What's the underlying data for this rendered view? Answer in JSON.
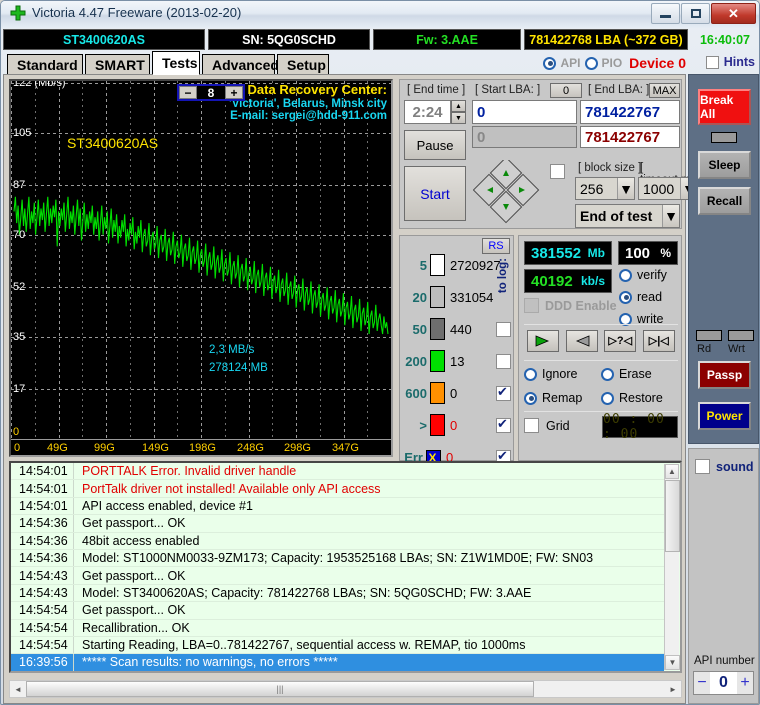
{
  "window": {
    "title": "Victoria 4.47  Freeware (2013-02-20)",
    "icon": "green-cross-icon",
    "buttons": {
      "minimize": "minimize-icon",
      "maximize": "maximize-icon",
      "close": "✕"
    }
  },
  "infobar": {
    "model": "ST3400620AS",
    "serial": "SN: 5QG0SCHD",
    "firmware": "Fw: 3.AAE",
    "capacity": "781422768 LBA (~372 GB)",
    "clock": "16:40:07",
    "colors": {
      "model": "#17e8e8",
      "serial": "#ffffff",
      "firmware": "#24e024",
      "capacity": "#ffe400",
      "clock": "#0bbd0b"
    }
  },
  "tabs": [
    {
      "label": "Standard",
      "active": false
    },
    {
      "label": "SMART",
      "active": false
    },
    {
      "label": "Tests",
      "active": true
    },
    {
      "label": "Advanced",
      "active": false
    },
    {
      "label": "Setup",
      "active": false
    }
  ],
  "device": {
    "api_label": "API",
    "pio_label": "PIO",
    "selected": "API",
    "device_label": "Device 0",
    "hints_label": "Hints",
    "hints_checked": false
  },
  "chart_data": {
    "type": "line",
    "title": "ST3400620AS",
    "ylabel": "(Mb/s)",
    "xlabel": "",
    "ytick_labels": [
      "122",
      "105",
      "87",
      "70",
      "52",
      "35",
      "17",
      "0"
    ],
    "yticks": [
      122,
      105,
      87,
      70,
      52,
      35,
      17,
      0
    ],
    "ylim": [
      0,
      122
    ],
    "xtick_labels": [
      "0",
      "49G",
      "99G",
      "149G",
      "198G",
      "248G",
      "298G",
      "347G"
    ],
    "xlim": [
      0,
      372
    ],
    "grid": true,
    "line_color": "#00e000",
    "background": "#000000",
    "unit_label": "122 (Mb/s)",
    "series": [
      {
        "name": "read speed",
        "values": [
          78,
          83,
          74,
          80,
          70,
          76,
          82,
          73,
          79,
          71,
          77,
          83,
          72,
          78,
          74,
          81,
          70,
          76,
          82,
          73,
          79,
          75,
          81,
          71,
          77,
          83,
          73,
          79,
          74,
          80,
          76,
          82,
          66,
          78,
          73,
          79,
          75,
          81,
          71,
          77,
          83,
          72,
          78,
          74,
          80,
          70,
          76,
          82,
          73,
          79,
          68,
          75,
          81,
          71,
          77,
          72,
          78,
          74,
          80,
          70,
          76,
          72,
          78,
          68,
          74,
          80,
          70,
          76,
          72,
          78,
          67,
          73,
          79,
          69,
          75,
          71,
          77,
          67,
          73,
          69,
          75,
          71,
          77,
          66,
          72,
          68,
          74,
          70,
          76,
          65,
          71,
          67,
          73,
          69,
          75,
          64,
          70,
          72,
          66,
          68,
          74,
          63,
          69,
          71,
          65,
          67,
          73,
          62,
          68,
          70,
          64,
          66,
          72,
          61,
          67,
          69,
          63,
          65,
          71,
          60,
          66,
          68,
          62,
          64,
          70,
          59,
          65,
          67,
          61,
          63,
          69,
          58,
          64,
          66,
          60,
          62,
          68,
          57,
          63,
          65,
          59,
          61,
          67,
          56,
          62,
          64,
          58,
          60,
          66,
          55,
          61,
          63,
          57,
          59,
          65,
          54,
          60,
          62,
          56,
          58,
          64,
          53,
          59,
          61,
          55,
          57,
          63,
          52,
          58,
          60,
          54,
          56,
          62,
          51,
          57,
          59,
          53,
          55,
          61,
          50,
          56,
          58,
          52,
          54,
          60,
          49,
          55,
          57,
          51,
          53,
          59,
          48,
          54,
          56,
          50,
          52,
          58,
          47,
          53,
          55,
          49,
          51,
          57,
          46,
          52,
          54,
          48,
          50,
          56,
          45,
          51,
          53,
          47,
          49,
          55,
          44,
          50,
          52,
          46,
          48,
          54,
          43,
          49,
          51,
          45,
          47,
          53,
          42,
          48,
          50,
          44,
          46,
          52,
          41,
          47,
          49,
          43,
          45,
          51,
          40,
          46,
          48,
          42,
          44,
          50,
          39,
          45,
          47,
          41,
          43,
          49,
          38,
          44,
          46,
          40,
          42,
          48,
          37,
          43,
          45,
          39,
          41,
          47,
          36,
          42,
          44,
          38,
          40,
          46,
          37,
          41,
          43,
          39,
          36,
          42,
          38,
          40,
          36
        ]
      }
    ],
    "annotations": [
      {
        "text": "2,3 MB/s",
        "color": "#19d7f2"
      },
      {
        "text": "278124 MB",
        "color": "#19d7f2"
      }
    ],
    "watermark": {
      "line1": "Data Recovery Center:",
      "line2": "'Victoria', Belarus, Minsk city",
      "line3": "E-mail: sergei@hdd-911.com"
    },
    "zoom_control": {
      "minus": "−",
      "value": "8",
      "plus": "+"
    }
  },
  "controls": {
    "end_time_label": "[ End time ]",
    "end_time_value": "2:24",
    "start_lba_label": "[ Start LBA: ]",
    "start_lba_button": "0",
    "start_lba_value": "0",
    "start_lba_value2": "0",
    "end_lba_label": "[ End LBA: ]",
    "end_lba_button": "MAX",
    "end_lba_value": "781422767",
    "end_lba_value2": "781422767",
    "pause_button": "Pause",
    "start_button": "Start",
    "block_size_label": "[ block size ]",
    "block_size_value": "256",
    "timeout_label": "[ timeout,ms ]",
    "timeout_value": "1000",
    "end_of_test_value": "End of test"
  },
  "counters": {
    "rs_button": "RS",
    "to_log_label": "to log:",
    "rows": [
      {
        "threshold": "5",
        "color": "#ffffff",
        "value": "2720927",
        "checkbox": null
      },
      {
        "threshold": "20",
        "color": "#bdbdbd",
        "value": "331054",
        "checkbox": null
      },
      {
        "threshold": "50",
        "color": "#6e6e6e",
        "value": "440",
        "checkbox": false
      },
      {
        "threshold": "200",
        "color": "#00e000",
        "value": "13",
        "checkbox": false
      },
      {
        "threshold": "600",
        "color": "#ff9000",
        "value": "0",
        "checkbox": true
      },
      {
        "threshold": ">",
        "color": "#ff0000",
        "value": "0",
        "checkbox": true
      },
      {
        "threshold": "Err",
        "color": "#0000d0",
        "value": "0",
        "checkbox": true
      }
    ]
  },
  "stats": {
    "processed_value": "381552",
    "processed_unit": "Mb",
    "percent_value": "100",
    "percent_unit": "%",
    "speed_value": "40192",
    "speed_unit": "kb/s",
    "ddd_label": "DDD Enable",
    "ddd_checked": false,
    "modes": [
      {
        "label": "verify",
        "selected": false
      },
      {
        "label": "read",
        "selected": true
      },
      {
        "label": "write",
        "selected": false
      }
    ],
    "transport": [
      {
        "name": "play-forward-icon"
      },
      {
        "name": "play-reverse-icon"
      },
      {
        "name": "seek-random-icon"
      },
      {
        "name": "seek-end-icon"
      }
    ],
    "actions": [
      {
        "label": "Ignore",
        "selected": false
      },
      {
        "label": "Erase",
        "selected": false
      },
      {
        "label": "Remap",
        "selected": true
      },
      {
        "label": "Restore",
        "selected": false
      }
    ],
    "grid_label": "Grid",
    "grid_checked": false,
    "timer_display": "00 : 00 : 00"
  },
  "log": {
    "entries": [
      {
        "time": "14:54:01",
        "message": "PORTTALK Error. Invalid driver handle",
        "color": "#e00000",
        "selected": false
      },
      {
        "time": "14:54:01",
        "message": "PortTalk driver not installed! Available only API access",
        "color": "#e00000",
        "selected": false
      },
      {
        "time": "14:54:01",
        "message": "API access enabled, device #1",
        "color": "#000000",
        "selected": false
      },
      {
        "time": "14:54:36",
        "message": "Get passport... OK",
        "color": "#000000",
        "selected": false
      },
      {
        "time": "14:54:36",
        "message": "48bit access enabled",
        "color": "#000000",
        "selected": false
      },
      {
        "time": "14:54:36",
        "message": "Model: ST1000NM0033-9ZM173; Capacity: 1953525168 LBAs; SN: Z1W1MD0E; FW: SN03",
        "color": "#000000",
        "selected": false
      },
      {
        "time": "14:54:43",
        "message": "Get passport... OK",
        "color": "#000000",
        "selected": false
      },
      {
        "time": "14:54:43",
        "message": "Model: ST3400620AS; Capacity: 781422768 LBAs; SN: 5QG0SCHD; FW: 3.AAE",
        "color": "#000000",
        "selected": false
      },
      {
        "time": "14:54:54",
        "message": "Get passport... OK",
        "color": "#000000",
        "selected": false
      },
      {
        "time": "14:54:54",
        "message": "Recallibration... OK",
        "color": "#000000",
        "selected": false
      },
      {
        "time": "14:54:54",
        "message": "Starting Reading, LBA=0..781422767, sequential access w. REMAP, tio 1000ms",
        "color": "#000000",
        "selected": false
      },
      {
        "time": "16:39:56",
        "message": "***** Scan results: no warnings, no errors *****",
        "color": "#ffffff",
        "selected": true
      }
    ]
  },
  "sidebar": {
    "break_all": "Break All",
    "sleep": "Sleep",
    "recall": "Recall",
    "rd_label": "Rd",
    "wrt_label": "Wrt",
    "passp": "Passp",
    "power": "Power",
    "sound_label": "sound",
    "sound_checked": false,
    "api_number_label": "API number",
    "api_number_minus": "−",
    "api_number_value": "0",
    "api_number_plus": "+"
  }
}
